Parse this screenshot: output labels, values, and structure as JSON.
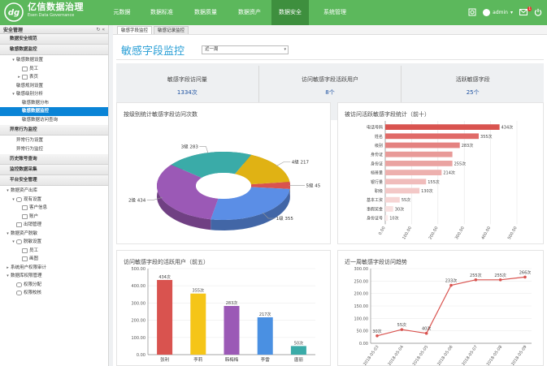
{
  "header": {
    "brand_title": "亿信数据治理",
    "brand_subtitle": "Esen Data Governance",
    "logo_text": "dg",
    "nav": [
      {
        "label": "元数据"
      },
      {
        "label": "数据标准"
      },
      {
        "label": "数据质量"
      },
      {
        "label": "数据资产"
      },
      {
        "label": "数据安全"
      },
      {
        "label": "系统管理"
      }
    ],
    "active_nav_index": 4,
    "user": "admin",
    "notification_count": "1"
  },
  "sidebar": {
    "title": "安全管理",
    "sec1": "数据安全规范",
    "sec2": "敏感数据监控",
    "tree_a": [
      {
        "label": "敏感数据设置",
        "depth": 1,
        "caret": "▾"
      },
      {
        "label": "员工",
        "depth": 2,
        "caret": "",
        "icon": "table-icon"
      },
      {
        "label": "表页",
        "depth": 2,
        "caret": "▸",
        "icon": "table-icon"
      },
      {
        "label": "敏感规则设置",
        "depth": 1,
        "caret": ""
      },
      {
        "label": "敏感级别分析",
        "depth": 1,
        "caret": "▾"
      },
      {
        "label": "敏感数据分布",
        "depth": 2,
        "caret": ""
      },
      {
        "label": "敏感数据监控",
        "depth": 2,
        "caret": "",
        "selected": true
      },
      {
        "label": "敏感数据访问查询",
        "depth": 2,
        "caret": ""
      }
    ],
    "sec3": "异常行为监控",
    "tree_b": [
      {
        "label": "异常行为设置",
        "depth": 1
      },
      {
        "label": "异常行为监控",
        "depth": 1
      }
    ],
    "sec4": "历史账号查询",
    "sec5": "监控数据采集",
    "sec6": "平台安全管理",
    "tree_c": [
      {
        "label": "数据资产出库",
        "depth": 0,
        "caret": "▾"
      },
      {
        "label": "现有设置",
        "depth": 1,
        "caret": "▾",
        "icon": "database-icon"
      },
      {
        "label": "客户信息",
        "depth": 2,
        "caret": "",
        "icon": "table-icon"
      },
      {
        "label": "账户",
        "depth": 2,
        "caret": "",
        "icon": "table-icon"
      },
      {
        "label": "出销管理",
        "depth": 1,
        "caret": "",
        "icon": "table-icon"
      },
      {
        "label": "数据资产脱敏",
        "depth": 0,
        "caret": "▾"
      },
      {
        "label": "脱敏设置",
        "depth": 1,
        "caret": "▾",
        "icon": "database-icon"
      },
      {
        "label": "员工",
        "depth": 2,
        "caret": "",
        "icon": "table-icon"
      },
      {
        "label": "画图",
        "depth": 2,
        "caret": "",
        "icon": "table-icon"
      },
      {
        "label": "系统用户权限审计",
        "depth": 0,
        "caret": "▸"
      },
      {
        "label": "数据库权限管理",
        "depth": 0,
        "caret": "▾"
      },
      {
        "label": "权限分配",
        "depth": 1,
        "caret": "",
        "icon": "database-icon"
      },
      {
        "label": "权限校核",
        "depth": 1,
        "caret": "",
        "icon": "database-icon"
      }
    ]
  },
  "main": {
    "tabs": [
      {
        "label": "敏感字段监控"
      },
      {
        "label": "敏感记录监控"
      }
    ],
    "page_title": "敏感字段监控",
    "period_select": "近一周",
    "stats": [
      {
        "label": "敏感字段访问量",
        "value": "1334次"
      },
      {
        "label": "访问敏感字段活跃用户",
        "value": "8个"
      },
      {
        "label": "活跃敏感字段",
        "value": "25个"
      }
    ]
  },
  "colors": {
    "header_green": "#5cb85c",
    "active_nav": "#3e8f3e",
    "title_blue": "#2a9fd6",
    "selected_blue": "#0a84d6",
    "bar_red": "#d9534f",
    "line_red": "#d9534f"
  },
  "chart_data": [
    {
      "type": "pie",
      "title": "按级别统计敏感字段访问次数",
      "categories": [
        "1级",
        "2级",
        "3级",
        "4级",
        "5级"
      ],
      "values": [
        355,
        434,
        283,
        217,
        45
      ],
      "colors": [
        "#5b8ee6",
        "#9b59b6",
        "#3aaba8",
        "#e0b214",
        "#d9534f"
      ]
    },
    {
      "type": "bar",
      "orientation": "horizontal",
      "title": "被访问活跃敏感字段统计（前十）",
      "categories": [
        "电话号码",
        "姓名",
        "级别",
        "身份证",
        "身份证",
        "档普量",
        "银行量",
        "职级",
        "基本工资",
        "事假奖金",
        "身份证号"
      ],
      "values": [
        434,
        355,
        283,
        255,
        255,
        214,
        155,
        130,
        55,
        30,
        10
      ],
      "value_labels": [
        "434次",
        "355次",
        "283次",
        "",
        "255次",
        "214次",
        "155次",
        "130次",
        "55次",
        "30次",
        "10次"
      ],
      "xlim": [
        0,
        500
      ],
      "xticks": [
        "0.00",
        "100.00",
        "200.00",
        "300.00",
        "400.00",
        "500.00"
      ]
    },
    {
      "type": "bar",
      "title": "访问敏感字段的活跃用户（前五）",
      "categories": [
        "张利",
        "李莉",
        "韩梅梅",
        "李雷",
        "唐丽"
      ],
      "values": [
        434,
        355,
        283,
        217,
        50
      ],
      "value_labels": [
        "434次",
        "355次",
        "283次",
        "217次",
        "50次"
      ],
      "colors": [
        "#d9534f",
        "#f5c518",
        "#9b59b6",
        "#4a90e2",
        "#3aaba8"
      ],
      "ylim": [
        0,
        500
      ],
      "yticks": [
        "0.00",
        "100.00",
        "200.00",
        "300.00",
        "400.00",
        "500.00"
      ]
    },
    {
      "type": "line",
      "title": "近一周敏感字段访问趋势",
      "x": [
        "2018-05-03",
        "2018-05-04",
        "2018-05-05",
        "2018-05-06",
        "2018-05-07",
        "2018-05-08",
        "2018-05-09"
      ],
      "values": [
        30,
        55,
        40,
        233,
        255,
        255,
        266
      ],
      "value_labels": [
        "30次",
        "55次",
        "40次",
        "233次",
        "255次",
        "255次",
        "266次"
      ],
      "ylim": [
        0,
        300
      ],
      "yticks": [
        "0.00",
        "50.00",
        "100.00",
        "150.00",
        "200.00",
        "250.00",
        "300.00"
      ]
    }
  ]
}
